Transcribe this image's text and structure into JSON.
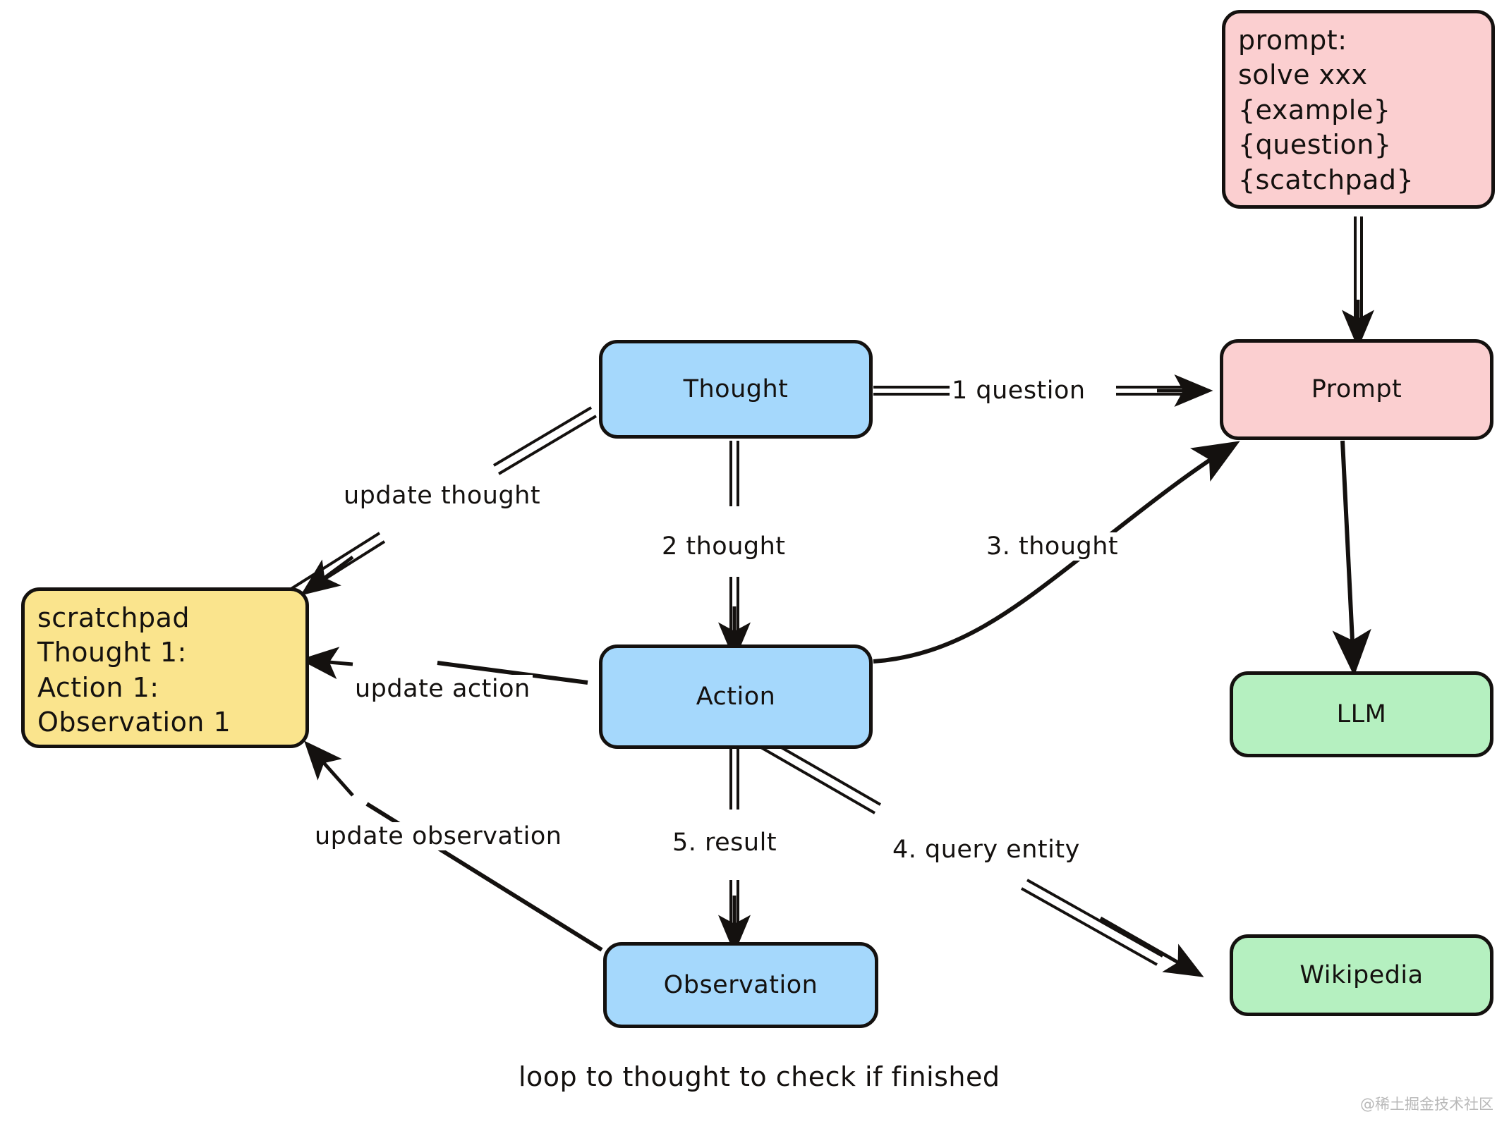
{
  "diagram": {
    "title": "ReAct agent loop diagram",
    "caption": "loop to thought to check if finished",
    "watermark": "@稀土掘金技术社区",
    "colors": {
      "blue": "#a5d8fc",
      "pink": "#fbcfd0",
      "green": "#b5f0c0",
      "yellow": "#fae48d",
      "stroke": "#14110f",
      "background": "#ffffff"
    },
    "nodes": [
      {
        "id": "prompt_template",
        "label": "prompt:\nsolve xxx\n{example}\n{question}\n{scatchpad}",
        "color": "pink"
      },
      {
        "id": "prompt",
        "label": "Prompt",
        "color": "pink"
      },
      {
        "id": "llm",
        "label": "LLM",
        "color": "green"
      },
      {
        "id": "wikipedia",
        "label": "Wikipedia",
        "color": "green"
      },
      {
        "id": "thought",
        "label": "Thought",
        "color": "blue"
      },
      {
        "id": "action",
        "label": "Action",
        "color": "blue"
      },
      {
        "id": "observation",
        "label": "Observation",
        "color": "blue"
      },
      {
        "id": "scratchpad",
        "label": "scratchpad\nThought 1:\nAction 1:\nObservation 1",
        "color": "yellow"
      }
    ],
    "edges": [
      {
        "id": "e_tpl_prompt",
        "from": "prompt_template",
        "to": "prompt",
        "label": ""
      },
      {
        "id": "e_thought_prompt",
        "from": "thought",
        "to": "prompt",
        "label": "1 question"
      },
      {
        "id": "e_prompt_llm",
        "from": "prompt",
        "to": "llm",
        "label": ""
      },
      {
        "id": "e_thought_action",
        "from": "thought",
        "to": "action",
        "label": "2 thought"
      },
      {
        "id": "e_action_prompt",
        "from": "action",
        "to": "prompt",
        "label": "3. thought"
      },
      {
        "id": "e_action_wikipedia",
        "from": "action",
        "to": "wikipedia",
        "label": "4. query entity"
      },
      {
        "id": "e_action_observation",
        "from": "action",
        "to": "observation",
        "label": "5. result"
      },
      {
        "id": "e_thought_scratchpad",
        "from": "thought",
        "to": "scratchpad",
        "label": "update thought"
      },
      {
        "id": "e_action_scratchpad",
        "from": "action",
        "to": "scratchpad",
        "label": "update action"
      },
      {
        "id": "e_observation_scratchpad",
        "from": "observation",
        "to": "scratchpad",
        "label": "update observation"
      }
    ]
  }
}
